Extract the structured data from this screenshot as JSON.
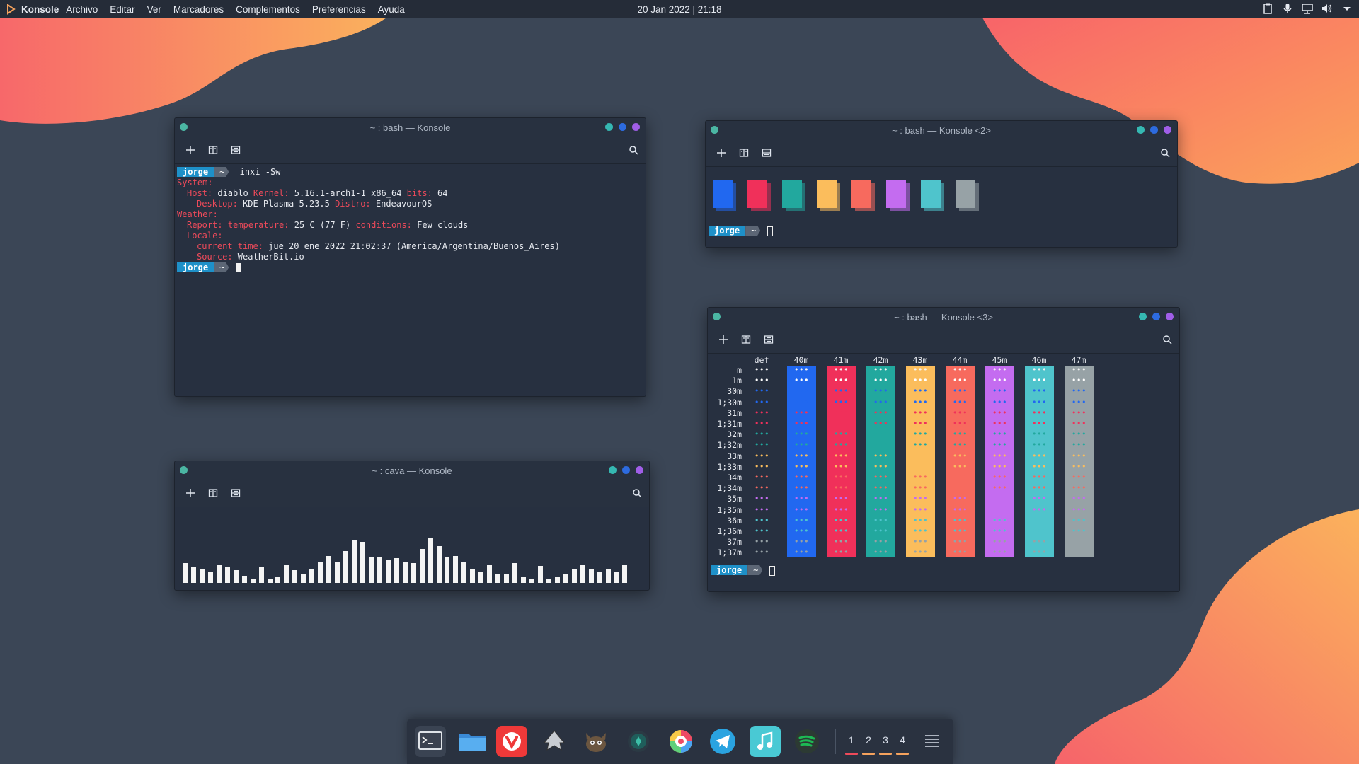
{
  "topbar": {
    "app_name": "Konsole",
    "menus": [
      "Archivo",
      "Editar",
      "Ver",
      "Marcadores",
      "Complementos",
      "Preferencias",
      "Ayuda"
    ],
    "clock": "20 Jan 2022 | 21:18"
  },
  "windows": {
    "w1": {
      "title": "~ : bash — Konsole",
      "prompt_user": "jorge",
      "prompt_dir": "~",
      "command": "inxi -Sw",
      "lines": [
        {
          "indent": 0,
          "parts": [
            [
              "k",
              "System:"
            ]
          ]
        },
        {
          "indent": 1,
          "parts": [
            [
              "k",
              "Host:"
            ],
            [
              "v",
              " diablo "
            ],
            [
              "k",
              "Kernel:"
            ],
            [
              "v",
              " 5.16.1-arch1-1 x86_64 "
            ],
            [
              "k",
              "bits:"
            ],
            [
              "v",
              " 64"
            ]
          ]
        },
        {
          "indent": 2,
          "parts": [
            [
              "k",
              "Desktop:"
            ],
            [
              "v",
              " KDE Plasma 5.23.5 "
            ],
            [
              "k",
              "Distro:"
            ],
            [
              "v",
              " EndeavourOS"
            ]
          ]
        },
        {
          "indent": 0,
          "parts": [
            [
              "k",
              "Weather:"
            ]
          ]
        },
        {
          "indent": 1,
          "parts": [
            [
              "k",
              "Report:"
            ],
            [
              "v",
              " "
            ],
            [
              "k",
              "temperature:"
            ],
            [
              "v",
              " 25 C (77 F) "
            ],
            [
              "k",
              "conditions:"
            ],
            [
              "v",
              " Few clouds"
            ]
          ]
        },
        {
          "indent": 1,
          "parts": [
            [
              "k",
              "Locale:"
            ]
          ]
        },
        {
          "indent": 2,
          "parts": [
            [
              "k",
              "current time:"
            ],
            [
              "v",
              " jue 20 ene 2022 21:02:37 (America/Argentina/Buenos_Aires)"
            ]
          ]
        },
        {
          "indent": 2,
          "parts": [
            [
              "k",
              "Source:"
            ],
            [
              "v",
              " WeatherBit.io"
            ]
          ]
        }
      ]
    },
    "w2": {
      "title": "~ : bash — Konsole <2>",
      "prompt_user": "jorge",
      "prompt_dir": "~",
      "swatches": [
        "#2168f0",
        "#f0305a",
        "#22a89e",
        "#fbbd5c",
        "#f76a5e",
        "#c46cf0",
        "#4fc4cc",
        "#97a2a6"
      ]
    },
    "w3": {
      "title": "~ : bash — Konsole <3>",
      "prompt_user": "jorge",
      "prompt_dir": "~",
      "columns": [
        "def",
        "40m",
        "41m",
        "42m",
        "43m",
        "44m",
        "45m",
        "46m",
        "47m"
      ],
      "column_colors": [
        "",
        "#2168f0",
        "#f0305a",
        "#22a89e",
        "#fbbd5c",
        "#f76a5e",
        "#c46cf0",
        "#4fc4cc",
        "#97a2a6"
      ],
      "rows": [
        "m",
        "1m",
        "30m",
        "1;30m",
        "31m",
        "1;31m",
        "32m",
        "1;32m",
        "33m",
        "1;33m",
        "34m",
        "1;34m",
        "35m",
        "1;35m",
        "36m",
        "1;36m",
        "37m",
        "1;37m"
      ],
      "row_colors": [
        "#f2f2f2",
        "#ffffff",
        "#2168f0",
        "#2168f0",
        "#f0305a",
        "#f0305a",
        "#22a89e",
        "#22a89e",
        "#fbbd5c",
        "#fbbd5c",
        "#f76a5e",
        "#f76a5e",
        "#c46cf0",
        "#c46cf0",
        "#4fc4cc",
        "#4fc4cc",
        "#97a2a6",
        "#97a2a6"
      ],
      "dot_glyph": "•••"
    },
    "w4": {
      "title": "~ : cava — Konsole",
      "bar_levels": [
        0.28,
        0.22,
        0.2,
        0.16,
        0.26,
        0.22,
        0.18,
        0.1,
        0.06,
        0.22,
        0.06,
        0.08,
        0.26,
        0.18,
        0.13,
        0.2,
        0.3,
        0.38,
        0.3,
        0.45,
        0.6,
        0.58,
        0.36,
        0.36,
        0.33,
        0.35,
        0.3,
        0.28,
        0.48,
        0.64,
        0.52,
        0.36,
        0.38,
        0.3,
        0.2,
        0.16,
        0.26,
        0.13,
        0.13,
        0.28,
        0.08,
        0.06,
        0.24,
        0.06,
        0.08,
        0.13,
        0.2,
        0.26,
        0.2,
        0.16,
        0.2,
        0.16,
        0.26
      ]
    }
  },
  "dock": {
    "apps": [
      {
        "name": "konsole",
        "color": "#3a4352"
      },
      {
        "name": "files",
        "color": "#3a4352"
      },
      {
        "name": "vivaldi",
        "color": "#ef3939"
      },
      {
        "name": "inkscape",
        "color": "transparent"
      },
      {
        "name": "gimp",
        "color": "transparent"
      },
      {
        "name": "keepass",
        "color": "transparent"
      },
      {
        "name": "color-picker",
        "color": "transparent"
      },
      {
        "name": "telegram",
        "color": "#2aa3e0"
      },
      {
        "name": "music",
        "color": "#49c9d4"
      },
      {
        "name": "spotify",
        "color": "#1db954"
      }
    ],
    "workspaces": [
      "1",
      "2",
      "3",
      "4"
    ],
    "active_workspace": "1"
  },
  "colors": {
    "background": "#3a4555",
    "blob_gradient_start": "#f7686a",
    "blob_gradient_end": "#fbb55c"
  }
}
